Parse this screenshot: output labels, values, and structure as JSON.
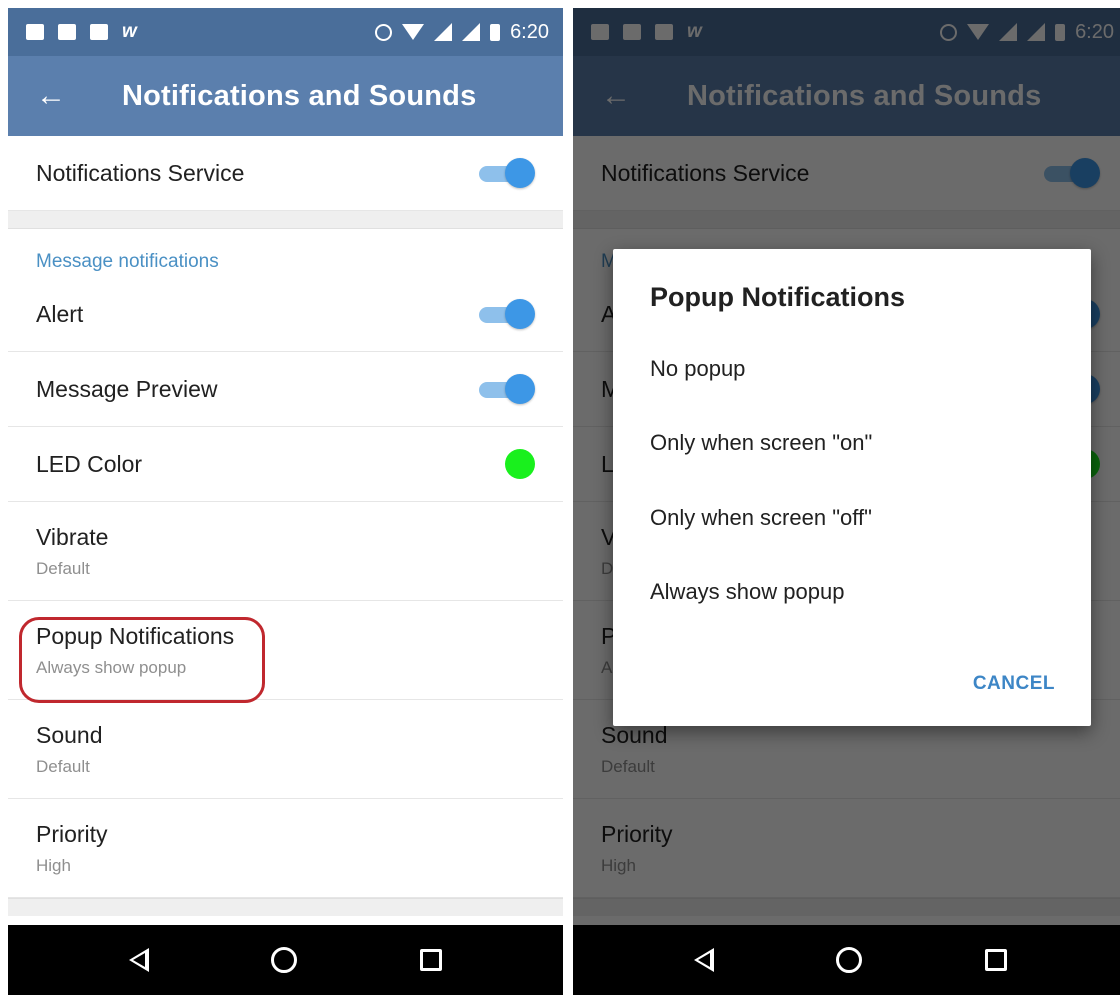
{
  "status_bar": {
    "time": "6:20",
    "app_icon": "w"
  },
  "app_bar": {
    "back_icon": "←",
    "title": "Notifications and Sounds"
  },
  "settings": {
    "notifications_service": {
      "label": "Notifications Service",
      "enabled": true
    },
    "section_header": "Message notifications",
    "alert": {
      "label": "Alert",
      "enabled": true
    },
    "message_preview": {
      "label": "Message Preview",
      "enabled": true
    },
    "led_color": {
      "label": "LED Color",
      "color": "#19f01d"
    },
    "vibrate": {
      "label": "Vibrate",
      "value": "Default"
    },
    "popup_notifications": {
      "label": "Popup Notifications",
      "value": "Always show popup"
    },
    "sound": {
      "label": "Sound",
      "value": "Default"
    },
    "priority": {
      "label": "Priority",
      "value": "High"
    }
  },
  "dialog": {
    "title": "Popup Notifications",
    "options": [
      "No popup",
      "Only when screen \"on\"",
      "Only when screen \"off\"",
      "Always show popup"
    ],
    "cancel_label": "CANCEL"
  },
  "colors": {
    "app_bar": "#5b7fad",
    "status_bar": "#4a6e9a",
    "accent": "#3d97e6",
    "section_text": "#4a90c4",
    "highlight": "#c0282e"
  }
}
